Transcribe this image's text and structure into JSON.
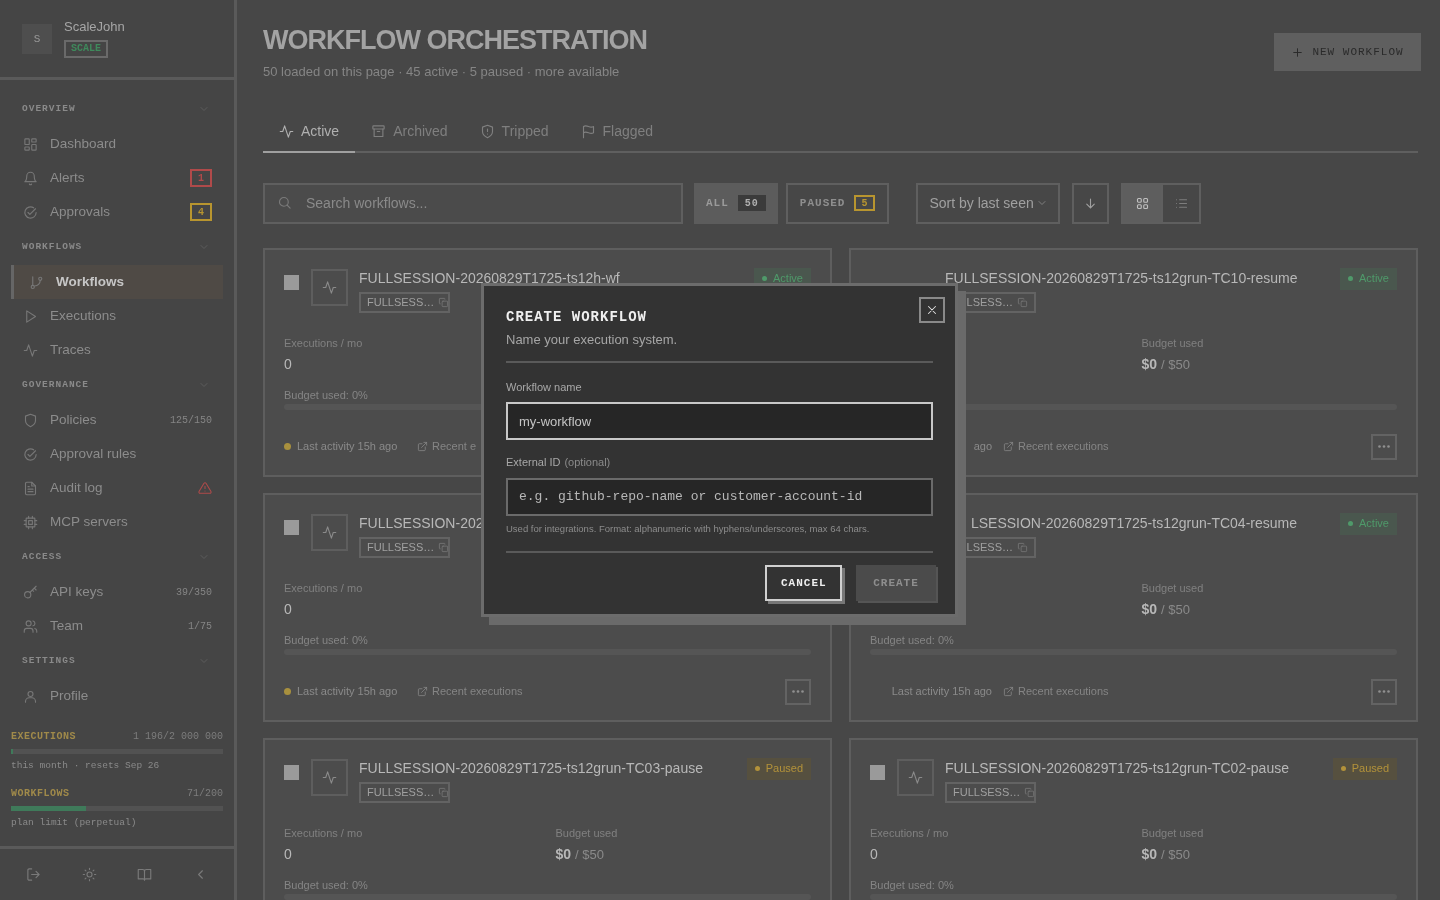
{
  "sidebar": {
    "avatar": "S",
    "user_name": "ScaleJohn",
    "plan_badge": "SCALE",
    "sections": [
      {
        "title": "OVERVIEW",
        "items": [
          {
            "label": "Dashboard",
            "selected": false
          },
          {
            "label": "Alerts",
            "selected": false,
            "trail": {
              "kind": "badge",
              "text": "1",
              "color": "#b04a4a"
            }
          },
          {
            "label": "Approvals",
            "selected": false,
            "trail": {
              "kind": "badge",
              "text": "4",
              "color": "#b8952f"
            }
          }
        ]
      },
      {
        "title": "WORKFLOWS",
        "items": [
          {
            "label": "Workflows",
            "selected": true
          },
          {
            "label": "Executions",
            "selected": false
          },
          {
            "label": "Traces",
            "selected": false
          }
        ]
      },
      {
        "title": "GOVERNANCE",
        "items": [
          {
            "label": "Policies",
            "selected": false,
            "trail": {
              "kind": "count",
              "text": "125/150"
            }
          },
          {
            "label": "Approval rules",
            "selected": false
          },
          {
            "label": "Audit log",
            "selected": false,
            "trail": {
              "kind": "warning"
            }
          },
          {
            "label": "MCP servers",
            "selected": false
          }
        ]
      },
      {
        "title": "ACCESS",
        "items": [
          {
            "label": "API keys",
            "selected": false,
            "trail": {
              "kind": "count",
              "text": "39/350"
            }
          },
          {
            "label": "Team",
            "selected": false,
            "trail": {
              "kind": "count",
              "text": "1/75"
            }
          }
        ]
      },
      {
        "title": "SETTINGS",
        "items": [
          {
            "label": "Profile",
            "selected": false
          }
        ]
      }
    ],
    "usage": [
      {
        "label": "EXECUTIONS",
        "value": "1 196/2 000 000",
        "level": 0.003,
        "caption": "this month · resets Sep 26"
      },
      {
        "label": "WORKFLOWS",
        "value": "71/200",
        "level": 0.355,
        "caption": "plan limit (perpetual)"
      }
    ]
  },
  "page": {
    "title": "WORKFLOW ORCHESTRATION",
    "subtitle": "50 loaded on this page · 45 active · 5 paused · more available",
    "new_button": "NEW WORKFLOW"
  },
  "tabs": [
    {
      "label": "Active",
      "selected": true
    },
    {
      "label": "Archived",
      "selected": false
    },
    {
      "label": "Tripped",
      "selected": false
    },
    {
      "label": "Flagged",
      "selected": false
    }
  ],
  "toolbar": {
    "search": {
      "placeholder": "Search workflows..."
    },
    "filters": [
      {
        "label": "ALL",
        "count": "50",
        "selected": true,
        "color": "#3b3b3b"
      },
      {
        "label": "PAUSED",
        "count": "5",
        "selected": false,
        "color": "#b8952f"
      }
    ],
    "sort": "Sort by last seen",
    "views": [
      {
        "kind": "grid",
        "selected": true
      },
      {
        "kind": "list",
        "selected": false
      }
    ]
  },
  "cards": [
    {
      "checked": false,
      "title": "FULLSESSION-20260829T1725-ts12h-wf",
      "status": {
        "kind": "active",
        "label": "Active"
      },
      "chip": "FULLSESS…",
      "executions_label": "Executions / mo",
      "executions_value": "0",
      "budget_pct": "Budget used: 0%",
      "level": 0,
      "activity": "Last activity 15h ago",
      "recent": "Recent e"
    },
    {
      "title": "FULLSESSION-20260829T1725-ts12grun-TC10-resume",
      "status": {
        "kind": "active",
        "label": "Active"
      },
      "chip": "LSESS…",
      "budget_label": "Budget used",
      "budget_value": "$0",
      "budget_limit": "/ $50",
      "level": 0,
      "activity": "ago",
      "recent": "Recent executions",
      "more": true
    },
    {
      "checked": false,
      "title": "FULLSESSION-202",
      "chip": "FULLSESS…",
      "executions_label": "Executions / mo",
      "executions_value": "0",
      "budget_pct": "Budget used: 0%",
      "level": 0,
      "activity": "Last activity 15h ago",
      "recent": "Recent executions",
      "more": true
    },
    {
      "title": "LSESSION-20260829T1725-ts12grun-TC04-resume",
      "status": {
        "kind": "active",
        "label": "Active"
      },
      "chip": "LSESS…",
      "budget_label": "Budget used",
      "budget_value": "$0",
      "budget_limit": "/ $50",
      "budget_pct": "Budget used: 0%",
      "level": 0,
      "activity": "Last activity 15h ago",
      "recent": "Recent executions",
      "more": true
    },
    {
      "checked": false,
      "title": "FULLSESSION-20260829T1725-ts12grun-TC03-pause",
      "status": {
        "kind": "paused",
        "label": "Paused"
      },
      "chip": "FULLSESS…",
      "executions_label": "Executions / mo",
      "executions_value": "0",
      "budget_label": "Budget used",
      "budget_value": "$0",
      "budget_limit": "/ $50",
      "budget_pct": "Budget used: 0%",
      "level": 0
    },
    {
      "checked": false,
      "title": "FULLSESSION-20260829T1725-ts12grun-TC02-pause",
      "status": {
        "kind": "paused",
        "label": "Paused"
      },
      "chip": "FULLSESS…",
      "executions_label": "Executions / mo",
      "executions_value": "0",
      "budget_label": "Budget used",
      "budget_value": "$0",
      "budget_limit": "/ $50",
      "budget_pct": "Budget used: 0%",
      "level": 0
    }
  ],
  "modal": {
    "title": "CREATE WORKFLOW",
    "subtitle": "Name your execution system.",
    "fields": [
      {
        "kind": "name",
        "label": "Workflow name",
        "value": "my-workflow"
      },
      {
        "kind": "id",
        "label": "External ID",
        "note": "(optional)",
        "placeholder": "e.g. github-repo-name or customer-account-id",
        "hint": "Used for integrations. Format: alphanumeric with hyphens/underscores, max 64 chars."
      }
    ],
    "buttons": [
      {
        "label": "CANCEL",
        "disabled": false
      },
      {
        "label": "CREATE",
        "disabled": true
      }
    ]
  }
}
